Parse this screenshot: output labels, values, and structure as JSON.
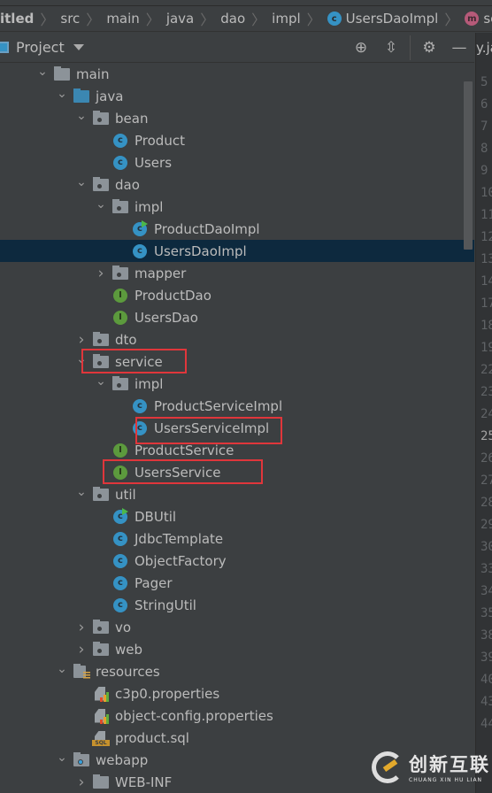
{
  "breadcrumb": [
    {
      "label": "itled",
      "bold": true
    },
    {
      "label": "src"
    },
    {
      "label": "main"
    },
    {
      "label": "java"
    },
    {
      "label": "dao"
    },
    {
      "label": "impl"
    },
    {
      "label": "UsersDaoImpl",
      "icon": "class-icon"
    },
    {
      "label": "selectByCond",
      "icon": "method-icon"
    }
  ],
  "panel": {
    "title": "Project",
    "tools": [
      "locate-icon",
      "collapse-all-icon",
      "gear-icon",
      "minimize-icon"
    ]
  },
  "tree": [
    {
      "label": "main",
      "level": 0,
      "type": "folder",
      "state": "open"
    },
    {
      "label": "java",
      "level": 1,
      "type": "src-folder",
      "state": "open"
    },
    {
      "label": "bean",
      "level": 2,
      "type": "package",
      "state": "open"
    },
    {
      "label": "Product",
      "level": 3,
      "type": "class"
    },
    {
      "label": "Users",
      "level": 3,
      "type": "class"
    },
    {
      "label": "dao",
      "level": 2,
      "type": "package",
      "state": "open"
    },
    {
      "label": "impl",
      "level": 3,
      "type": "package",
      "state": "open"
    },
    {
      "label": "ProductDaoImpl",
      "level": 4,
      "type": "class-main"
    },
    {
      "label": "UsersDaoImpl",
      "level": 4,
      "type": "class",
      "selected": true
    },
    {
      "label": "mapper",
      "level": 3,
      "type": "package",
      "state": "closed"
    },
    {
      "label": "ProductDao",
      "level": 3,
      "type": "interface"
    },
    {
      "label": "UsersDao",
      "level": 3,
      "type": "interface"
    },
    {
      "label": "dto",
      "level": 2,
      "type": "package",
      "state": "closed"
    },
    {
      "label": "service",
      "level": 2,
      "type": "package",
      "state": "open",
      "highlight": true
    },
    {
      "label": "impl",
      "level": 3,
      "type": "package",
      "state": "open"
    },
    {
      "label": "ProductServiceImpl",
      "level": 4,
      "type": "class"
    },
    {
      "label": "UsersServiceImpl",
      "level": 4,
      "type": "class",
      "highlight": true
    },
    {
      "label": "ProductService",
      "level": 3,
      "type": "interface"
    },
    {
      "label": "UsersService",
      "level": 3,
      "type": "interface",
      "highlight": true
    },
    {
      "label": "util",
      "level": 2,
      "type": "package",
      "state": "open"
    },
    {
      "label": "DBUtil",
      "level": 3,
      "type": "class-main"
    },
    {
      "label": "JdbcTemplate",
      "level": 3,
      "type": "class"
    },
    {
      "label": "ObjectFactory",
      "level": 3,
      "type": "class"
    },
    {
      "label": "Pager",
      "level": 3,
      "type": "class"
    },
    {
      "label": "StringUtil",
      "level": 3,
      "type": "class"
    },
    {
      "label": "vo",
      "level": 2,
      "type": "package",
      "state": "closed"
    },
    {
      "label": "web",
      "level": 2,
      "type": "package",
      "state": "closed"
    },
    {
      "label": "resources",
      "level": 1,
      "type": "resources-folder",
      "state": "open"
    },
    {
      "label": "c3p0.properties",
      "level": 2,
      "type": "properties"
    },
    {
      "label": "object-config.properties",
      "level": 2,
      "type": "properties"
    },
    {
      "label": "product.sql",
      "level": 2,
      "type": "sql"
    },
    {
      "label": "webapp",
      "level": 1,
      "type": "web-folder",
      "state": "open"
    },
    {
      "label": "WEB-INF",
      "level": 2,
      "type": "folder",
      "state": "closed"
    }
  ],
  "editor": {
    "tab_fragment": "y.ja",
    "current_line": "25",
    "line_numbers": [
      "5",
      "6",
      "7",
      "8",
      "9",
      "10",
      "11",
      "12",
      "13",
      "14",
      "17",
      "18",
      "19",
      "22",
      "23",
      "24",
      "25",
      "26",
      "27",
      "28",
      "29",
      "30",
      "33",
      "34",
      "35",
      "38",
      "39",
      "40",
      "43",
      "44"
    ]
  },
  "watermark": {
    "cn": "创新互联",
    "en": "CHUANG XIN HU LIAN"
  },
  "colors": {
    "background": "#3c3f41",
    "selection": "#0d293e",
    "highlight_box": "#e0363b",
    "class": "#3592c4",
    "interface": "#5c9a3d"
  }
}
